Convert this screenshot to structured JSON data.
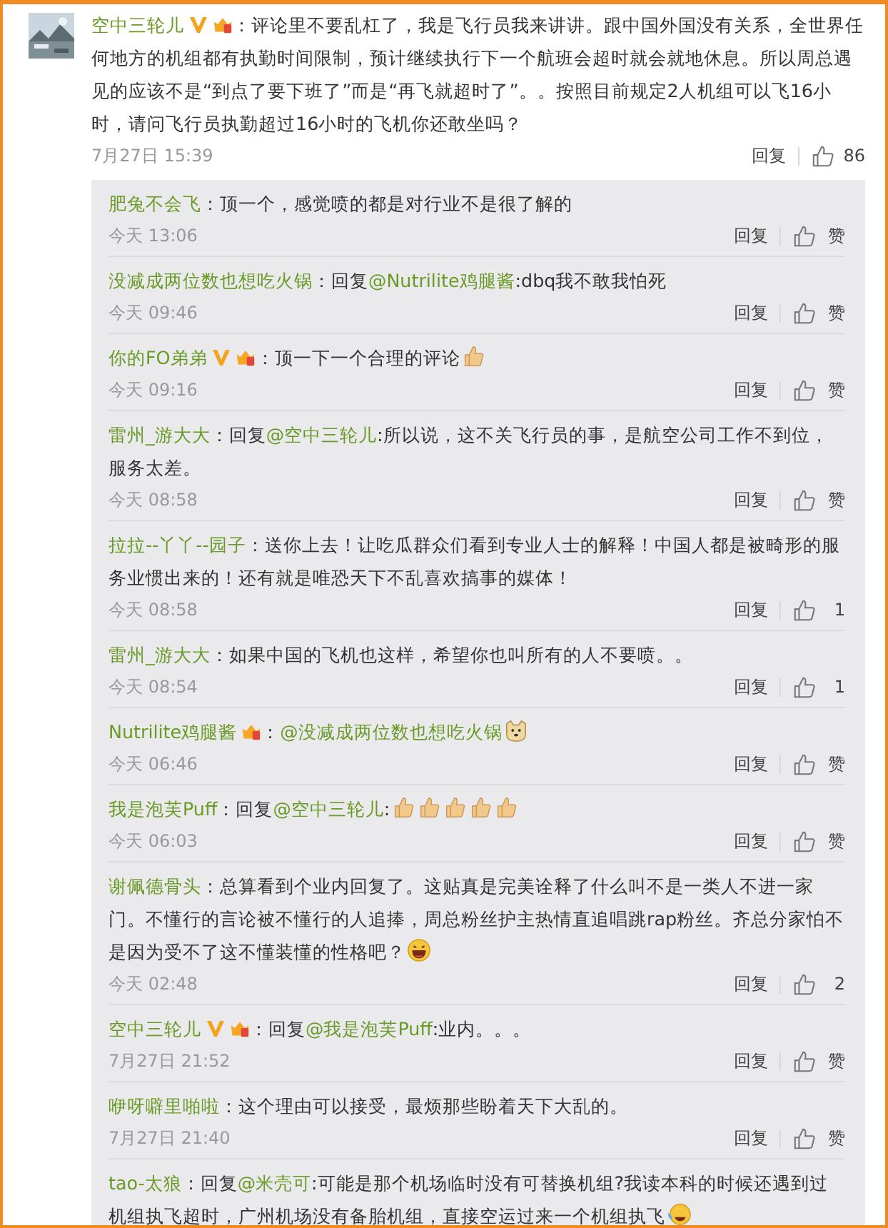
{
  "comment": {
    "user": "空中三轮儿",
    "badges": [
      {
        "kind": "verified"
      },
      {
        "kind": "member"
      }
    ],
    "content": [
      {
        "kind": "text",
        "text": "：评论里不要乱杠了，我是飞行员我来讲讲。跟中国外国没有关系，全世界任何地方的机组都有执勤时间限制，预计继续执行下一个航班会超时就会就地休息。所以周总遇见的应该不是“到点了要下班了”而是“再飞就超时了”。。按照目前规定2人机组可以飞16小时，请问飞行员执勤超过16小时的飞机你还敢坐吗？"
      }
    ],
    "time": "7月27日 15:39",
    "reply": "回复",
    "likes": "86",
    "replies": [
      {
        "user": "肥兔不会飞",
        "content": [
          {
            "kind": "text",
            "text": "：顶一个，感觉喷的都是对行业不是很了解的"
          }
        ],
        "time": "今天 13:06",
        "reply": "回复",
        "likes": "赞"
      },
      {
        "user": "没减成两位数也想吃火锅",
        "content": [
          {
            "kind": "text",
            "text": "：回复"
          },
          {
            "kind": "mention",
            "text": "@Nutrilite鸡腿酱"
          },
          {
            "kind": "text",
            "text": ":dbq我不敢我怕死"
          }
        ],
        "time": "今天 09:46",
        "reply": "回复",
        "likes": "赞"
      },
      {
        "user": "你的FO弟弟",
        "badges": [
          {
            "kind": "verified"
          },
          {
            "kind": "member"
          }
        ],
        "content": [
          {
            "kind": "text",
            "text": "：顶一下一个合理的评论"
          },
          {
            "kind": "thumbs_emoji"
          }
        ],
        "time": "今天 09:16",
        "reply": "回复",
        "likes": "赞"
      },
      {
        "user": "雷州_游大大",
        "content": [
          {
            "kind": "text",
            "text": "：回复"
          },
          {
            "kind": "mention",
            "text": "@空中三轮儿"
          },
          {
            "kind": "text",
            "text": ":所以说，这不关飞行员的事，是航空公司工作不到位，服务太差。"
          }
        ],
        "time": "今天 08:58",
        "reply": "回复",
        "likes": "赞"
      },
      {
        "user": "拉拉--丫丫--园子",
        "content": [
          {
            "kind": "text",
            "text": "：送你上去！让吃瓜群众们看到专业人士的解释！中国人都是被畸形的服务业惯出来的！还有就是唯恐天下不乱喜欢搞事的媒体！"
          }
        ],
        "time": "今天 08:58",
        "reply": "回复",
        "likes": "1"
      },
      {
        "user": "雷州_游大大",
        "content": [
          {
            "kind": "text",
            "text": "：如果中国的飞机也这样，希望你也叫所有的人不要喷。。"
          }
        ],
        "time": "今天 08:54",
        "reply": "回复",
        "likes": "1"
      },
      {
        "user": "Nutrilite鸡腿酱",
        "badges": [
          {
            "kind": "member"
          }
        ],
        "content": [
          {
            "kind": "text",
            "text": "："
          },
          {
            "kind": "mention",
            "text": "@没减成两位数也想吃火锅"
          },
          {
            "kind": "dog_emoji"
          }
        ],
        "time": "今天 06:46",
        "reply": "回复",
        "likes": "赞"
      },
      {
        "user": "我是泡芙Puff",
        "content": [
          {
            "kind": "text",
            "text": "：回复"
          },
          {
            "kind": "mention",
            "text": "@空中三轮儿"
          },
          {
            "kind": "text",
            "text": ":"
          },
          {
            "kind": "thumbs_emoji"
          },
          {
            "kind": "thumbs_emoji"
          },
          {
            "kind": "thumbs_emoji"
          },
          {
            "kind": "thumbs_emoji"
          },
          {
            "kind": "thumbs_emoji"
          }
        ],
        "time": "今天 06:03",
        "reply": "回复",
        "likes": "赞"
      },
      {
        "user": "谢佩德骨头",
        "content": [
          {
            "kind": "text",
            "text": "：总算看到个业内回复了。这贴真是完美诠释了什么叫不是一类人不进一家门。不懂行的言论被不懂行的人追捧，周总粉丝护主热情直追唱跳rap粉丝。齐总分家怕不是因为受不了这不懂装懂的性格吧？"
          },
          {
            "kind": "laugh_emoji"
          }
        ],
        "time": "今天 02:48",
        "reply": "回复",
        "likes": "2"
      },
      {
        "user": "空中三轮儿",
        "badges": [
          {
            "kind": "verified"
          },
          {
            "kind": "member"
          }
        ],
        "content": [
          {
            "kind": "text",
            "text": "：回复"
          },
          {
            "kind": "mention",
            "text": "@我是泡芙Puff"
          },
          {
            "kind": "text",
            "text": ":业内。。。"
          }
        ],
        "time": "7月27日 21:52",
        "reply": "回复",
        "likes": "赞"
      },
      {
        "user": "咿呀噼里啪啦",
        "content": [
          {
            "kind": "text",
            "text": "：这个理由可以接受，最烦那些盼着天下大乱的。"
          }
        ],
        "time": "7月27日 21:40",
        "reply": "回复",
        "likes": "赞"
      },
      {
        "user": "tao-太狼",
        "content": [
          {
            "kind": "text",
            "text": "：回复"
          },
          {
            "kind": "mention",
            "text": "@米壳可"
          },
          {
            "kind": "text",
            "text": ":可能是那个机场临时没有可替换机组?我读本科的时候还遇到过机组执飞超时，广州机场没有备胎机组，直接空运过来一个机组执飞"
          },
          {
            "kind": "cry_emoji"
          }
        ]
      }
    ]
  }
}
